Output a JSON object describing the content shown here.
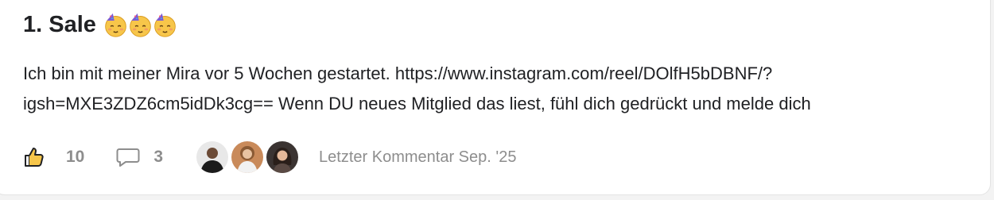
{
  "post": {
    "title": "1. Sale",
    "title_emojis": [
      "partying-face-emoji",
      "partying-face-emoji",
      "partying-face-emoji"
    ],
    "body_line1": "Ich bin mit meiner Mira vor 5 Wochen gestartet. https://www.instagram.com/reel/DOlfH5bDBNF/?",
    "body_line2": "igsh=MXE3ZDZ6cm5idDk3cg== Wenn DU neues Mitglied das liest, fühl dich gedrückt und melde dich"
  },
  "footer": {
    "like_icon": "thumbs-up-icon",
    "like_count": "10",
    "comment_icon": "comment-icon",
    "comment_count": "3",
    "avatars": [
      "commenter-avatar-1",
      "commenter-avatar-2",
      "commenter-avatar-3"
    ],
    "last_comment": "Letzter Kommentar Sep. '25"
  },
  "colors": {
    "text": "#202124",
    "muted": "#8d8d8d",
    "background": "#ffffff",
    "border": "#e3e3e3"
  }
}
